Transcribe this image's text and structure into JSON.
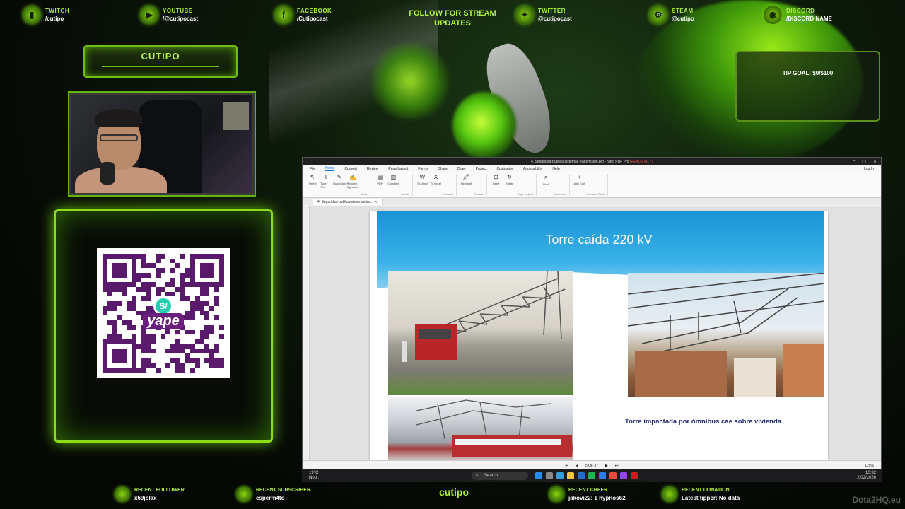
{
  "overlay": {
    "socials": [
      {
        "label": "TWITCH",
        "value": "/cutipo"
      },
      {
        "label": "YOUTUBE",
        "value": "/@cutipocast"
      },
      {
        "label": "FACEBOOK",
        "value": "/Cutipocast"
      },
      {
        "label": "TWITTER",
        "value": "@cutipocast"
      },
      {
        "label": "STEAM",
        "value": "@cutipo"
      },
      {
        "label": "DISCORD",
        "value": "/DISCORD NAME"
      }
    ],
    "follow_text": "FOLLOW FOR STREAM UPDATES",
    "streamer_name": "CUTIPO",
    "tip_goal": "TIP GOAL: $0/$100",
    "qr_logo_symbol": "S/",
    "qr_logo_word": "yape",
    "bottom_stats": [
      {
        "label": "RECENT FOLLOWER",
        "value": "x69jolax"
      },
      {
        "label": "RECENT SUBSCRIBER",
        "value": "esperm4to"
      },
      {
        "label": "RECENT CHEER",
        "value": "jakovi22:",
        "extra": "1",
        "extra2": "hypnos62"
      },
      {
        "label": "RECENT DONATION",
        "value": "Latest tipper: No data"
      }
    ],
    "bottom_name": "cutipo",
    "watermark": "Dota2HQ.eu"
  },
  "app": {
    "window_title": "4. Seguridad-publica-sistemas-transmision.pdf - Nitro PDF Pro",
    "window_title_badge": "(READ-ONLY)",
    "menu": [
      "File",
      "Home",
      "Convert",
      "Review",
      "Page Layout",
      "Forms",
      "Share",
      "Draw",
      "Protect",
      "Customize",
      "Accessibility",
      "Help"
    ],
    "active_menu": "Home",
    "login": "Log In",
    "ribbon_groups": [
      {
        "name": "Tools",
        "buttons": [
          "Select",
          "Type Text",
          "QuickSign",
          "Request Signature"
        ]
      },
      {
        "name": "Create",
        "buttons": [
          "PDF",
          "Combine"
        ]
      },
      {
        "name": "Convert",
        "buttons": [
          "To Word",
          "To Excel"
        ]
      },
      {
        "name": "Review",
        "buttons": [
          "Highlight"
        ]
      },
      {
        "name": "Page Layout",
        "buttons": [
          "Insert",
          "Rotate"
        ]
      },
      {
        "name": "Document",
        "buttons": [
          "Find"
        ]
      },
      {
        "name": "Favorite Tools",
        "buttons": [
          "Add Tool"
        ]
      }
    ],
    "doc_tab": "4. Seguridad-publica-sistemas-tra...",
    "slide_title": "Torre caída 220 kV",
    "caption": "Torre impactada por ómnibus cae sobre vivienda",
    "page_indicator": "5 OF 37",
    "zoom": "125%"
  },
  "taskbar": {
    "weather_temp": "19°C",
    "weather_desc": "Nubl.",
    "search_placeholder": "Search",
    "time": "10:32",
    "date": "2/02/2026"
  },
  "colors": {
    "accent_green": "#8cdc18",
    "slide_blue": "#1a93d6",
    "caption_navy": "#1c2873"
  }
}
